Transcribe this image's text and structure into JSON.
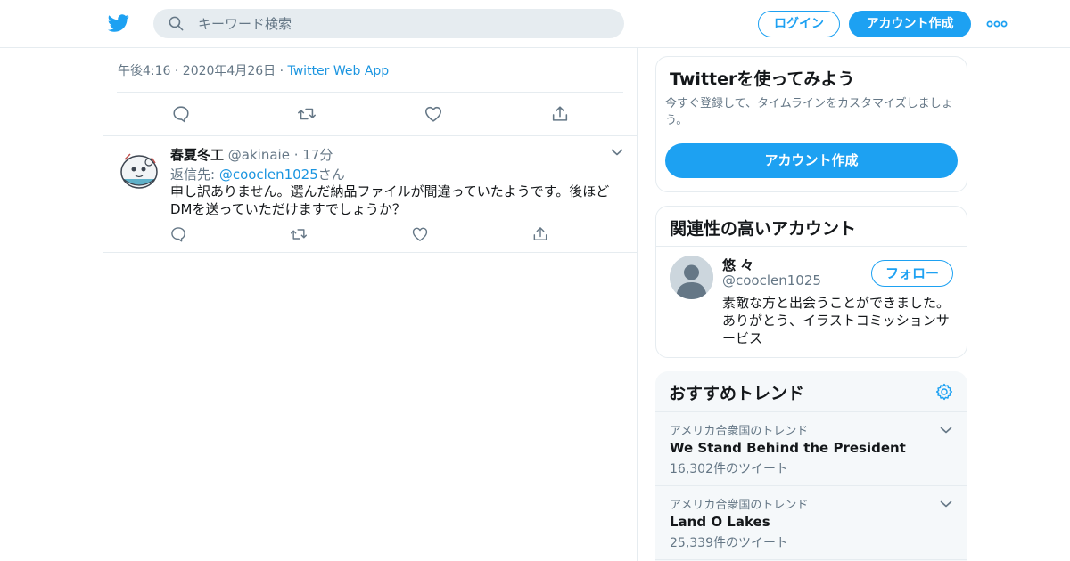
{
  "header": {
    "search_placeholder": "キーワード検索",
    "login_label": "ログイン",
    "signup_label": "アカウント作成"
  },
  "tweet": {
    "time": "午後4:16 · 2020年4月26日",
    "separator": " · ",
    "source": "Twitter Web App"
  },
  "reply": {
    "name": "春夏冬工",
    "handle": "@akinaie",
    "dot": " · ",
    "time": "17分",
    "reply_prefix": "返信先: ",
    "reply_to": "@cooclen1025",
    "reply_suffix": "さん",
    "text": "申し訳ありません。選んだ納品ファイルが間違っていたようです。後ほどDMを送っていただけますでしょうか？"
  },
  "sidebar": {
    "cta": {
      "title": "Twitterを使ってみよう",
      "text": "今すぐ登録して、タイムラインをカスタマイズしましょう。",
      "button": "アカウント作成"
    },
    "related": {
      "title": "関連性の高いアカウント",
      "name": "悠 々",
      "handle": "@cooclen1025",
      "follow": "フォロー",
      "bio": "素敵な方と出会うことができました。ありがとう、イラストコミッションサービス"
    },
    "trends": {
      "title": "おすすめトレンド",
      "items": [
        {
          "location": "アメリカ合衆国のトレンド",
          "name": "We Stand Behind the President",
          "count": "16,302件のツイート"
        },
        {
          "location": "アメリカ合衆国のトレンド",
          "name": "Land O Lakes",
          "count": "25,339件のツイート"
        }
      ]
    }
  },
  "colors": {
    "brand": "#1da1f2",
    "link": "#1b95e0",
    "text": "#14171a",
    "muted": "#657786",
    "border": "#e6ecf0",
    "panel": "#f5f8fa"
  }
}
